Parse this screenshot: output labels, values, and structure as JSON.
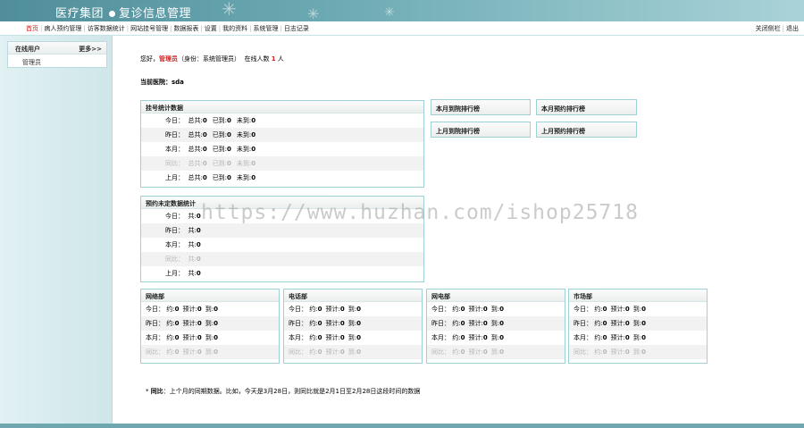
{
  "header": {
    "brand_left": "医疗集团",
    "brand_right": "复诊信息管理"
  },
  "nav": {
    "items": [
      "首页",
      "病人预约管理",
      "访客数据统计",
      "网站挂号管理",
      "数据报表",
      "设置",
      "我的资料",
      "系统管理",
      "日志记录"
    ],
    "right": [
      "关闭侧栏",
      "退出"
    ]
  },
  "sidebar": {
    "title": "在线用户",
    "more": "更多>>",
    "user": "管理员"
  },
  "greeting": {
    "hello": "您好，",
    "name": "管理员",
    "identity": "（身份：系统管理员）",
    "online_label": "在线人数",
    "online_count": "1",
    "unit": "人"
  },
  "current_dept": "当前医院：sda",
  "reg_stats": {
    "title": "挂号统计数据",
    "rows": [
      {
        "label": "今日：",
        "total_label": "总共:",
        "total": "0",
        "arrived_label": "已到:",
        "arrived": "0",
        "missed_label": "未到:",
        "missed": "0"
      },
      {
        "label": "昨日：",
        "total_label": "总共:",
        "total": "0",
        "arrived_label": "已到:",
        "arrived": "0",
        "missed_label": "未到:",
        "missed": "0"
      },
      {
        "label": "本月：",
        "total_label": "总共:",
        "total": "0",
        "arrived_label": "已到:",
        "arrived": "0",
        "missed_label": "未到:",
        "missed": "0"
      },
      {
        "label": "同比：",
        "total_label": "总共:",
        "total": "0",
        "arrived_label": "已到:",
        "arrived": "0",
        "missed_label": "未到:",
        "missed": "0"
      },
      {
        "label": "上月：",
        "total_label": "总共:",
        "total": "0",
        "arrived_label": "已到:",
        "arrived": "0",
        "missed_label": "未到:",
        "missed": "0"
      }
    ]
  },
  "pending_stats": {
    "title": "预约未定数据统计",
    "rows": [
      {
        "label": "今日：",
        "total_label": "共:",
        "total": "0"
      },
      {
        "label": "昨日：",
        "total_label": "共:",
        "total": "0"
      },
      {
        "label": "本月：",
        "total_label": "共:",
        "total": "0"
      },
      {
        "label": "同比：",
        "total_label": "共:",
        "total": "0"
      },
      {
        "label": "上月：",
        "total_label": "共:",
        "total": "0"
      }
    ]
  },
  "rankings": [
    "本月到院排行榜",
    "本月预约排行榜",
    "上月到院排行榜",
    "上月预约排行榜"
  ],
  "departments": [
    {
      "title": "网络部",
      "rows": [
        {
          "label": "今日：",
          "a": "约:",
          "av": "0",
          "b": "预计:",
          "bv": "0",
          "c": "到:",
          "cv": "0"
        },
        {
          "label": "昨日：",
          "a": "约:",
          "av": "0",
          "b": "预计:",
          "bv": "0",
          "c": "到:",
          "cv": "0"
        },
        {
          "label": "本月：",
          "a": "约:",
          "av": "0",
          "b": "预计:",
          "bv": "0",
          "c": "到:",
          "cv": "0"
        },
        {
          "label": "同比：",
          "a": "约:",
          "av": "0",
          "b": "预计:",
          "bv": "0",
          "c": "到:",
          "cv": "0"
        }
      ]
    },
    {
      "title": "电话部",
      "rows": [
        {
          "label": "今日：",
          "a": "约:",
          "av": "0",
          "b": "预计:",
          "bv": "0",
          "c": "到:",
          "cv": "0"
        },
        {
          "label": "昨日：",
          "a": "约:",
          "av": "0",
          "b": "预计:",
          "bv": "0",
          "c": "到:",
          "cv": "0"
        },
        {
          "label": "本月：",
          "a": "约:",
          "av": "0",
          "b": "预计:",
          "bv": "0",
          "c": "到:",
          "cv": "0"
        },
        {
          "label": "同比：",
          "a": "约:",
          "av": "0",
          "b": "预计:",
          "bv": "0",
          "c": "到:",
          "cv": "0"
        }
      ]
    },
    {
      "title": "网电部",
      "rows": [
        {
          "label": "今日：",
          "a": "约:",
          "av": "0",
          "b": "预计:",
          "bv": "0",
          "c": "到:",
          "cv": "0"
        },
        {
          "label": "昨日：",
          "a": "约:",
          "av": "0",
          "b": "预计:",
          "bv": "0",
          "c": "到:",
          "cv": "0"
        },
        {
          "label": "本月：",
          "a": "约:",
          "av": "0",
          "b": "预计:",
          "bv": "0",
          "c": "到:",
          "cv": "0"
        },
        {
          "label": "同比：",
          "a": "约:",
          "av": "0",
          "b": "预计:",
          "bv": "0",
          "c": "到:",
          "cv": "0"
        }
      ]
    },
    {
      "title": "市场部",
      "rows": [
        {
          "label": "今日：",
          "a": "约:",
          "av": "0",
          "b": "预计:",
          "bv": "0",
          "c": "到:",
          "cv": "0"
        },
        {
          "label": "昨日：",
          "a": "约:",
          "av": "0",
          "b": "预计:",
          "bv": "0",
          "c": "到:",
          "cv": "0"
        },
        {
          "label": "本月：",
          "a": "约:",
          "av": "0",
          "b": "预计:",
          "bv": "0",
          "c": "到:",
          "cv": "0"
        },
        {
          "label": "同比：",
          "a": "约:",
          "av": "0",
          "b": "预计:",
          "bv": "0",
          "c": "到:",
          "cv": "0"
        }
      ]
    }
  ],
  "note": {
    "prefix": "* ",
    "bold": "同比",
    "text": "：上个月的同期数据。比如，今天是3月28日，则同比就是2月1日至2月28日这段时间的数据"
  },
  "watermark": "https://www.huzhan.com/ishop25718"
}
